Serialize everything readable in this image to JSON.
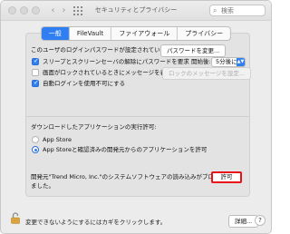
{
  "window": {
    "title": "セキュリティとプライバシー",
    "search_placeholder": "検索"
  },
  "tabs": [
    {
      "label": "一般",
      "active": true
    },
    {
      "label": "FileVault",
      "active": false
    },
    {
      "label": "ファイアウォール",
      "active": false
    },
    {
      "label": "プライバシー",
      "active": false
    }
  ],
  "login": {
    "password_set_text": "このユーザのログインパスワードが設定されています",
    "change_password_button": "パスワードを変更...",
    "require_password": {
      "label": "スリープとスクリーンセーバの解除にパスワードを要求",
      "checked": true
    },
    "start_label": "開始後:",
    "start_value": "5分後に",
    "show_message": {
      "label": "画面がロックされているときにメッセージを表示",
      "checked": false
    },
    "set_lock_message_button": "ロックのメッセージを設定...",
    "disable_auto_login": {
      "label": "自動ログインを使用不可にする",
      "checked": true
    }
  },
  "downloads": {
    "heading": "ダウンロードしたアプリケーションの実行許可:",
    "options": [
      {
        "label": "App Store",
        "checked": false
      },
      {
        "label": "App Storeと確認済みの開発元からのアプリケーションを許可",
        "checked": true
      }
    ]
  },
  "blocked": {
    "line1": "開発元\"Trend Micro, Inc.\"のシステムソフトウェアの読み込みがブロックされ",
    "line2": "ました。",
    "allow_button": "許可"
  },
  "footer": {
    "lock_text": "変更できないようにするにはカギをクリックします。",
    "advanced_button": "詳細...",
    "help_button": "?"
  },
  "colors": {
    "accent": "#2f7ff2",
    "highlight_border": "#e8121b"
  }
}
